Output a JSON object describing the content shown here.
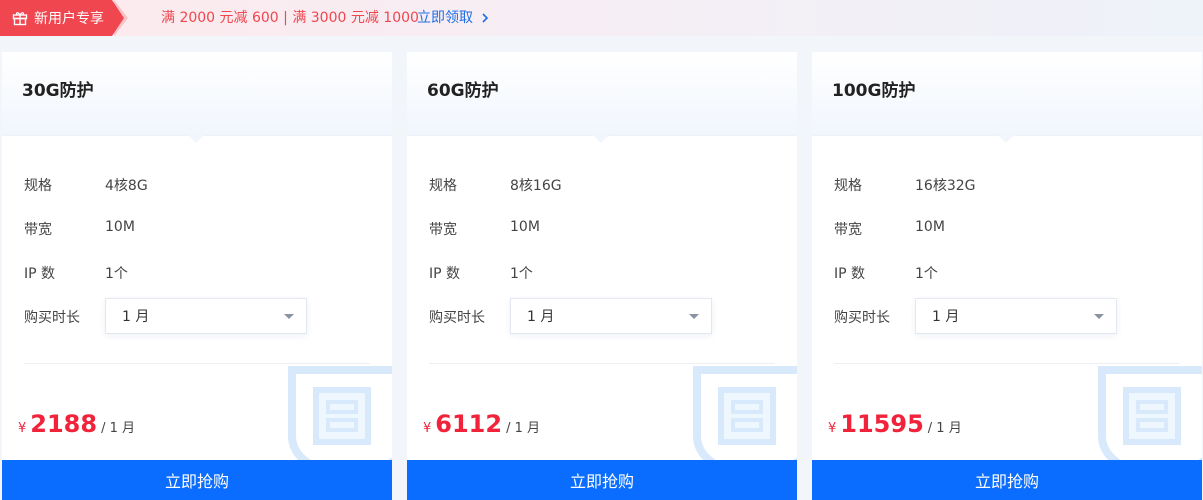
{
  "promo": {
    "tag": "新用户专享",
    "offer": "满 2000 元减 600 | 满 3000 元减 1000",
    "link": "立即领取"
  },
  "labels": {
    "spec": "规格",
    "bandwidth": "带宽",
    "ip": "IP 数",
    "duration": "购买时长"
  },
  "cards": [
    {
      "title": "30G防护",
      "spec": "4核8G",
      "bandwidth": "10M",
      "ip": "1个",
      "duration": "1 月",
      "currency": "¥",
      "price": "2188",
      "unit": "/ 1 月",
      "buy": "立即抢购"
    },
    {
      "title": "60G防护",
      "spec": "8核16G",
      "bandwidth": "10M",
      "ip": "1个",
      "duration": "1 月",
      "currency": "¥",
      "price": "6112",
      "unit": "/ 1 月",
      "buy": "立即抢购"
    },
    {
      "title": "100G防护",
      "spec": "16核32G",
      "bandwidth": "10M",
      "ip": "1个",
      "duration": "1 月",
      "currency": "¥",
      "price": "11595",
      "unit": "/ 1 月",
      "buy": "立即抢购"
    }
  ],
  "colors": {
    "accent": "#0a6dff",
    "price": "#f0233a",
    "promo_tag": "#f0464f",
    "link": "#1e6ee6"
  },
  "icons": {
    "promo_tag": "gift-icon",
    "promo_link": "chevron-right-icon",
    "select": "caret-down-icon",
    "watermark": "shield-icon"
  }
}
